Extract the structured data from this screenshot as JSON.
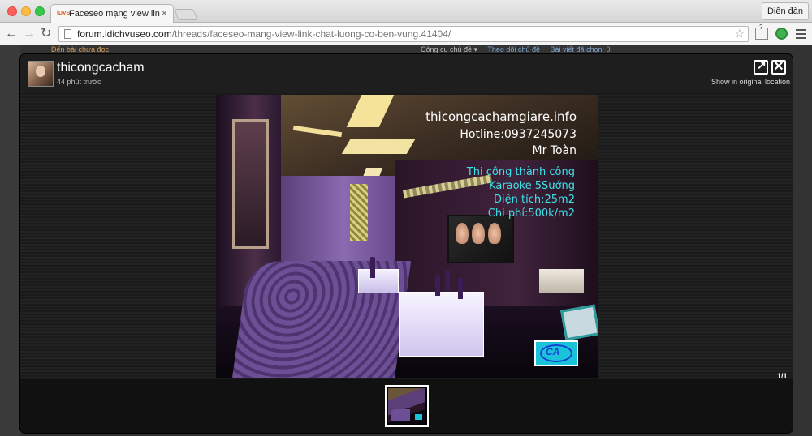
{
  "browser": {
    "tab_title": "Faceseo mạng view link chất lượng",
    "tab_favicon_text": "iDVS",
    "profile_button": "Diễn đàn",
    "url_host": "forum.idichvuseo.com",
    "url_path": "/threads/faceseo-mang-view-link-chat-luong-co-ben-vung.41404/"
  },
  "page_behind": {
    "unread_link": "Đến bài chưa đọc",
    "thread_tools": [
      "Công cụ chủ đề ▾",
      "Theo dõi chủ đề",
      "Bài viết đã chọn: 0"
    ]
  },
  "lightbox": {
    "username": "thicongcacham",
    "time_ago": "44 phút trước",
    "show_original": "Show in original location",
    "counter": "1/1",
    "photo_overlay": {
      "site": "thicongcachamgiare.info",
      "hotline": "Hotline:0937245073",
      "contact": "Mr Toàn",
      "line1": "Thi công thành công",
      "line2": "Karaoke 5Sướng",
      "line3": "Diện tích:25m2",
      "line4": "Chi phí:500k/m2",
      "logo": "CA"
    }
  },
  "colors": {
    "overlay_text": "#ffffff",
    "overlay_accent": "#3ee0e8",
    "logo_bg": "#1ac2da"
  },
  "icons": {
    "back": "arrow-left-icon",
    "forward": "arrow-right-icon",
    "reload": "reload-icon",
    "star": "star-icon",
    "open_original": "external-link-icon",
    "close": "close-icon",
    "menu": "hamburger-menu-icon"
  }
}
